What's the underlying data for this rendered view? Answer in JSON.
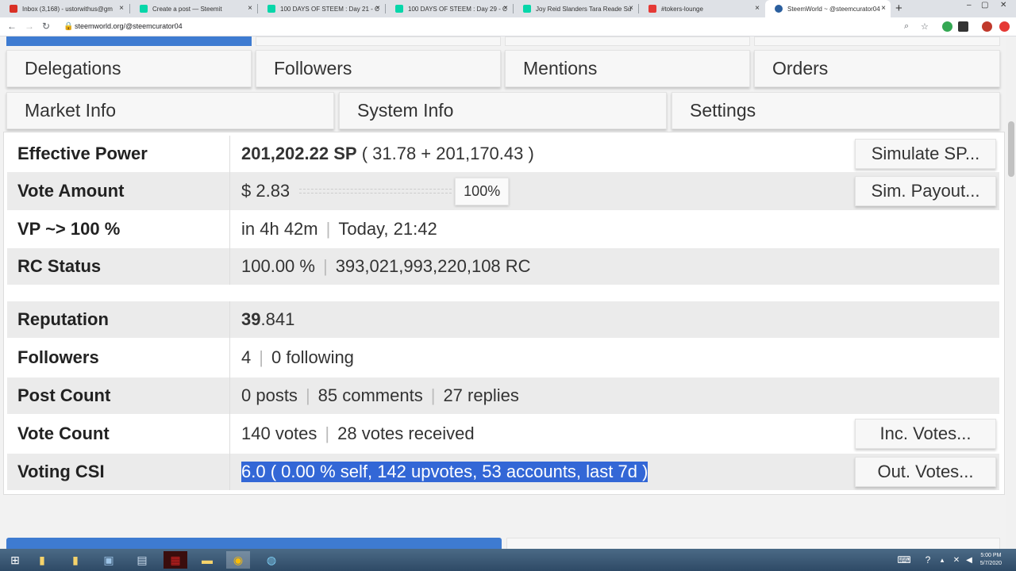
{
  "browser": {
    "tabs": [
      {
        "title": "Inbox (3,168) - ustorwithus@gm",
        "color": "#d93025"
      },
      {
        "title": "Create a post — Steemit",
        "color": "#06d6a9"
      },
      {
        "title": "100 DAYS OF STEEM : Day 21 - C",
        "color": "#06d6a9"
      },
      {
        "title": "100 DAYS OF STEEM : Day 29 - C",
        "color": "#06d6a9"
      },
      {
        "title": "Joy Reid Slanders Tara Reade Su",
        "color": "#06d6a9"
      },
      {
        "title": "#tokers-lounge",
        "color": "#e53935"
      },
      {
        "title": "SteemWorld ~ @steemcurator04",
        "color": "#2b5f9e"
      }
    ],
    "close_glyph": "×",
    "new_tab_glyph": "+",
    "url": "steemworld.org/@steemcurator04",
    "window_controls": [
      "–",
      "▢",
      "✕"
    ]
  },
  "nav_buttons": {
    "row1": [
      "Delegations",
      "Followers",
      "Mentions",
      "Orders"
    ],
    "row2": [
      "Market Info",
      "System Info",
      "Settings"
    ]
  },
  "stats": {
    "effective_power": {
      "label": "Effective Power",
      "value_bold": "201,202.22 SP",
      "value_rest": "( 31.78 + 201,170.43 )",
      "button": "Simulate SP..."
    },
    "vote_amount": {
      "label": "Vote Amount",
      "value": "$ 2.83",
      "percent": "100%",
      "button": "Sim. Payout..."
    },
    "vp": {
      "label": "VP ~> 100 %",
      "part1": "in 4h 42m",
      "part2": "Today, 21:42"
    },
    "rc_status": {
      "label": "RC Status",
      "part1": "100.00 %",
      "part2": "393,021,993,220,108 RC"
    },
    "reputation": {
      "label": "Reputation",
      "int": "39",
      "dec": ".841"
    },
    "followers": {
      "label": "Followers",
      "part1": "4",
      "part2": "0 following"
    },
    "post_count": {
      "label": "Post Count",
      "part1": "0 posts",
      "part2": "85 comments",
      "part3": "27 replies"
    },
    "vote_count": {
      "label": "Vote Count",
      "part1": "140 votes",
      "part2": "28 votes received",
      "button": "Inc. Votes..."
    },
    "voting_csi": {
      "label": "Voting CSI",
      "value": "6.0 ( 0.00 % self, 142 upvotes, 53 accounts, last 7d )",
      "button": "Out. Votes..."
    }
  },
  "separator": "|",
  "taskbar": {
    "time": "5:00 PM",
    "date": "5/7/2020"
  }
}
